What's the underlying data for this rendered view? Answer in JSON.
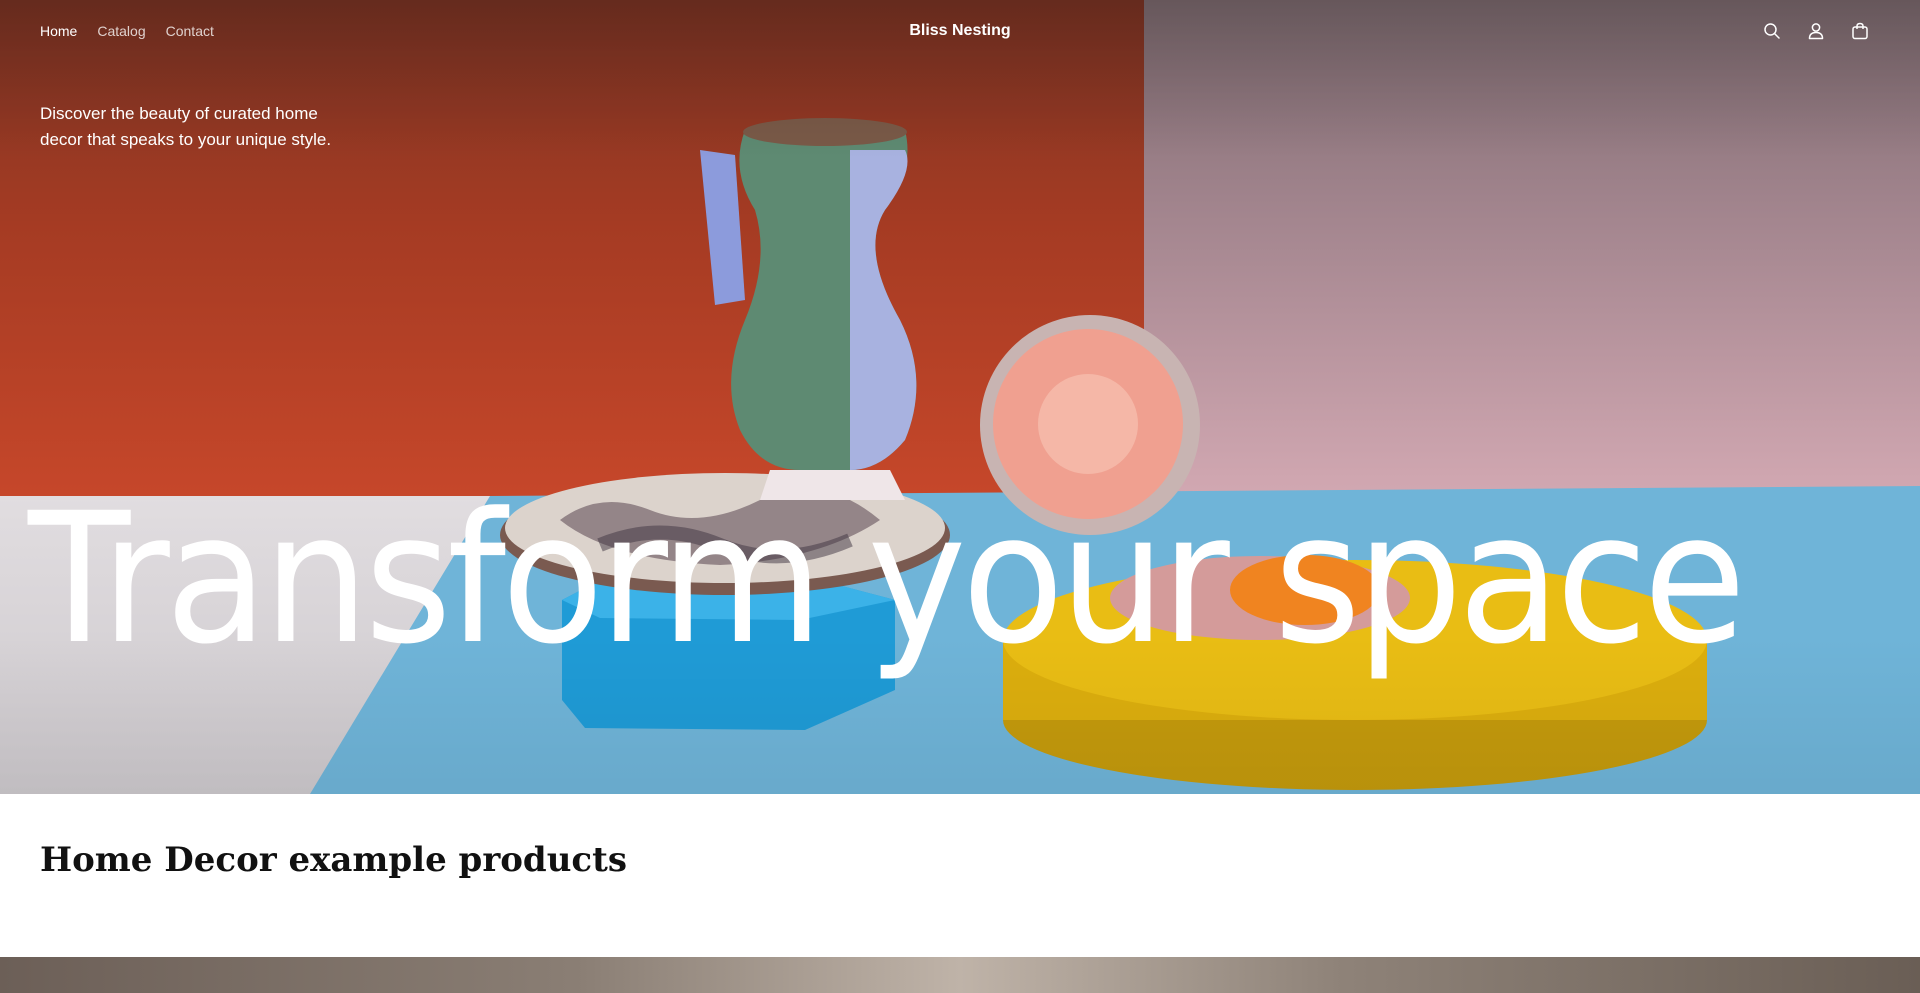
{
  "nav": {
    "links": [
      {
        "label": "Home",
        "active": true
      },
      {
        "label": "Catalog",
        "active": false
      },
      {
        "label": "Contact",
        "active": false
      }
    ],
    "brand": "Bliss Nesting",
    "icons": [
      "search-icon",
      "account-icon",
      "cart-icon"
    ]
  },
  "hero": {
    "tagline": "Discover the beauty of curated home decor that speaks to your unique style.",
    "title": "Transform your space"
  },
  "products_section": {
    "title": "Home Decor example products"
  },
  "colors": {
    "wall_left": "#a53b23",
    "wall_right": "#a0838c",
    "floor_blue": "#6fb4d8",
    "stand_blue": "#1f9bd6",
    "stand_yellow": "#e6b90f",
    "text_light": "#ffffff",
    "text_dark": "#111111"
  }
}
